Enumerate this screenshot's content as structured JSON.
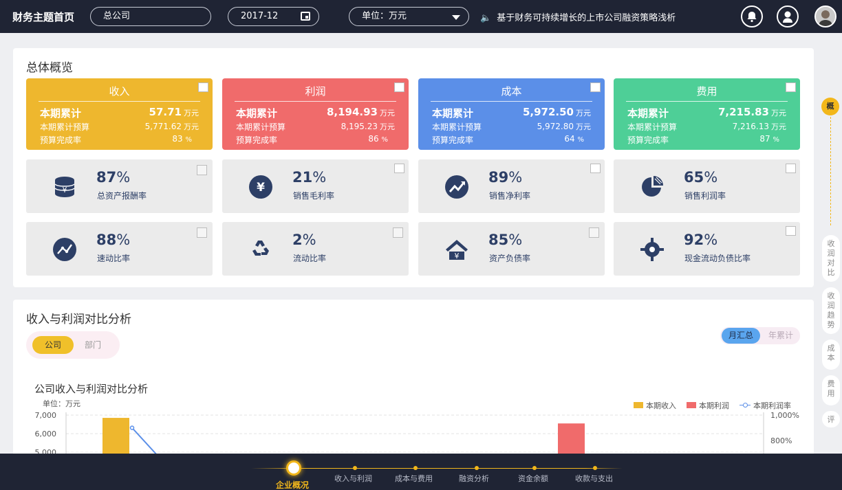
{
  "topbar": {
    "title": "财务主题首页",
    "company": "总公司",
    "period": "2017-12",
    "unit": "单位：万元",
    "notice": "基于财务可持续增长的上市公司融资策略浅析"
  },
  "overview": {
    "title": "总体概览",
    "stats": [
      {
        "head": "收入",
        "r1l": "本期累计",
        "r1v": "57.71",
        "r2l": "本期累计预算",
        "r2v": "5,771.62",
        "r3l": "预算完成率",
        "r3v": "83",
        "unit": "万元",
        "pct": "%",
        "color": "#eeb72e"
      },
      {
        "head": "利润",
        "r1l": "本期累计",
        "r1v": "8,194.93",
        "r2l": "本期累计预算",
        "r2v": "8,195.23",
        "r3l": "预算完成率",
        "r3v": "86",
        "unit": "万元",
        "pct": "%",
        "color": "#f06b6b"
      },
      {
        "head": "成本",
        "r1l": "本期累计",
        "r1v": "5,972.50",
        "r2l": "本期累计预算",
        "r2v": "5,972.80",
        "r3l": "预算完成率",
        "r3v": "64",
        "unit": "万元",
        "pct": "%",
        "color": "#5b8fe8"
      },
      {
        "head": "费用",
        "r1l": "本期累计",
        "r1v": "7,215.83",
        "r2l": "本期累计预算",
        "r2v": "7,216.13",
        "r3l": "预算完成率",
        "r3v": "87",
        "unit": "万元",
        "pct": "%",
        "color": "#4ecf97"
      }
    ],
    "kpis": [
      {
        "value": "87",
        "sign": "%",
        "label": "总资产报酬率",
        "icon": "coin-stack-icon"
      },
      {
        "value": "21",
        "sign": "%",
        "label": "销售毛利率",
        "icon": "yen-icon"
      },
      {
        "value": "89",
        "sign": "%",
        "label": "销售净利率",
        "icon": "trend-up-icon"
      },
      {
        "value": "65",
        "sign": "%",
        "label": "销售利润率",
        "icon": "pie-icon"
      },
      {
        "value": "88",
        "sign": "%",
        "label": "速动比率",
        "icon": "line-chart-icon"
      },
      {
        "value": "2",
        "sign": "%",
        "label": "流动比率",
        "icon": "recycle-icon"
      },
      {
        "value": "85",
        "sign": "%",
        "label": "资产负债率",
        "icon": "house-yen-icon"
      },
      {
        "value": "92",
        "sign": "%",
        "label": "现金流动负债比率",
        "icon": "target-icon"
      }
    ]
  },
  "rightnav": {
    "active": "概",
    "items": [
      "收润对比",
      "收润趋势",
      "成本",
      "费用",
      "评"
    ]
  },
  "analysis": {
    "title": "收入与利润对比分析",
    "seg_company": "公司",
    "seg_dept": "部门",
    "seg_month": "月汇总",
    "seg_year": "年累计",
    "chart_title": "公司收入与利润对比分析",
    "unit_label": "单位：万元",
    "legend": [
      "本期收入",
      "本期利润",
      "本期利润率"
    ]
  },
  "chart_data": {
    "type": "bar",
    "title": "公司收入与利润对比分析",
    "ylabel": "单位：万元",
    "y_ticks": [
      "7,000",
      "6,000",
      "5,000"
    ],
    "y2_ticks": [
      "1,000%",
      "800%"
    ],
    "ylim": [
      5000,
      7000
    ],
    "series": [
      {
        "name": "本期收入",
        "values": [
          6850
        ]
      },
      {
        "name": "本期利润",
        "values": [
          6550
        ]
      },
      {
        "name": "本期利润率",
        "values": [
          900
        ]
      }
    ]
  },
  "bottomnav": [
    "企业概况",
    "收入与利润",
    "成本与费用",
    "融资分析",
    "资金余额",
    "收款与支出"
  ],
  "colors": {
    "accent": "#f2b71b",
    "dark": "#1f2434"
  }
}
